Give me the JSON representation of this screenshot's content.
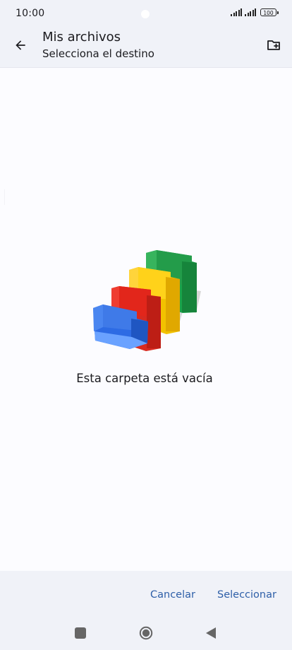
{
  "status_bar": {
    "time": "10:00",
    "battery": "100",
    "icons": [
      "signal-icon",
      "signal-icon",
      "battery-icon"
    ]
  },
  "app_bar": {
    "title": "Mis archivos",
    "subtitle": "Selecciona el destino",
    "back_icon": "arrow-back-icon",
    "new_folder_icon": "create-new-folder-icon"
  },
  "empty_state": {
    "illustration": "empty-folder-illustration",
    "message": "Esta carpeta está vacía"
  },
  "actions": {
    "cancel": "Cancelar",
    "select": "Seleccionar"
  },
  "navigation": {
    "recents_icon": "recents-icon",
    "home_icon": "home-icon",
    "back_icon": "back-triangle-icon"
  }
}
